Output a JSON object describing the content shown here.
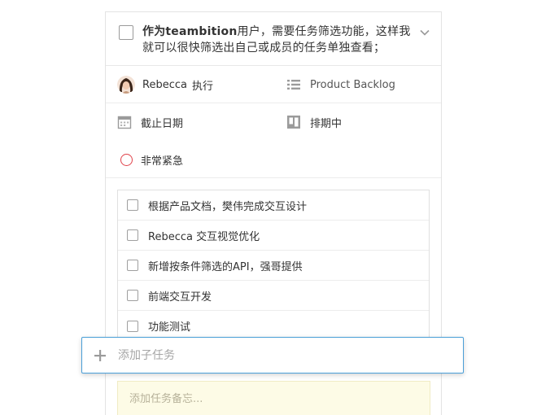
{
  "task": {
    "title_bold_prefix": "作为teambition",
    "title_rest": "用户，需要任务筛选功能，这样我就可以很快筛选出自己或成员的任务单独查看；"
  },
  "meta": {
    "assignee_name": "Rebecca",
    "assignee_role": "执行",
    "stage": "Product Backlog",
    "due_date_label": "截止日期",
    "schedule_label": "排期中",
    "priority_label": "非常紧急"
  },
  "subtasks": [
    {
      "text": "根据产品文档，樊伟完成交互设计"
    },
    {
      "text": "Rebecca 交互视觉优化"
    },
    {
      "text": "新增按条件筛选的API，强哥提供"
    },
    {
      "text": "前端交互开发"
    },
    {
      "text": "功能测试"
    }
  ],
  "add_subtask": {
    "placeholder": "添加子任务"
  },
  "note": {
    "placeholder": "添加任务备忘..."
  },
  "colors": {
    "accent": "#4a9fd8",
    "priority": "#e0424a",
    "note_bg": "#fdfbe6"
  }
}
